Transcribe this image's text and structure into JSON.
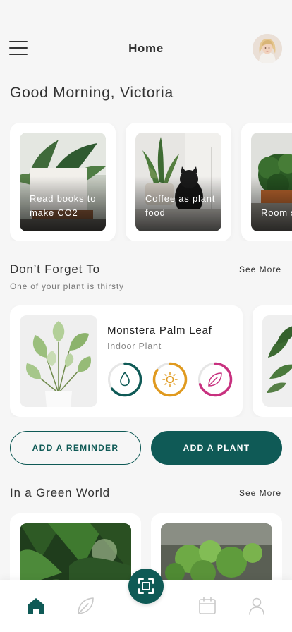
{
  "header": {
    "title": "Home",
    "menu_icon": "hamburger-menu-icon",
    "avatar_icon": "user-avatar"
  },
  "greeting": "Good Morning, Victoria",
  "tips": [
    {
      "text": "Read books to make CO2"
    },
    {
      "text": "Coffee as plant food"
    },
    {
      "text": "Room s matter"
    }
  ],
  "reminders": {
    "title": "Don’t Forget To",
    "subtitle": "One of your plant is thirsty",
    "see_more": "See More",
    "plant": {
      "name": "Monstera Palm Leaf",
      "type": "Indoor Plant",
      "care": [
        {
          "icon": "water-drop-icon",
          "color": "#0f5a56",
          "level": 0.65
        },
        {
          "icon": "sun-icon",
          "color": "#e09a1f",
          "level": 0.85
        },
        {
          "icon": "leaf-icon",
          "color": "#c8317f",
          "level": 0.7
        }
      ]
    }
  },
  "buttons": {
    "add_reminder": "ADD A REMINDER",
    "add_plant": "ADD A PLANT"
  },
  "green_world": {
    "title": "In a Green World",
    "see_more": "See More"
  },
  "nav": {
    "items": [
      "home-icon",
      "leaf-icon",
      "scan-icon",
      "calendar-icon",
      "profile-icon"
    ],
    "active": "home-icon"
  },
  "colors": {
    "accent": "#0f5a56",
    "background": "#f6f6f6",
    "sun": "#e09a1f",
    "leaf": "#c8317f"
  }
}
